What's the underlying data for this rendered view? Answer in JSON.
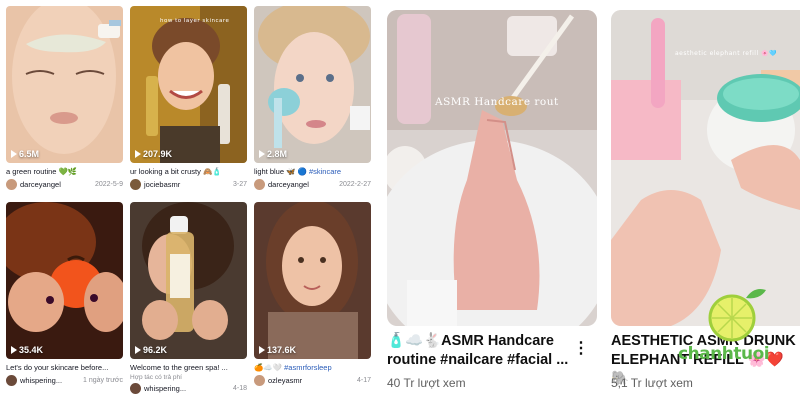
{
  "tiktok": {
    "cards": [
      {
        "views": "6.5M",
        "caption": "a green routine 💚🌿",
        "tag": "",
        "sub": "",
        "user": "darceyangel",
        "date": "2022-5-9"
      },
      {
        "views": "207.9K",
        "caption": "ur looking a bit crusty 🙈🧴",
        "tag": "",
        "sub": "",
        "user": "jociebasmr",
        "date": "3-27",
        "overlay": "how to layer skincare"
      },
      {
        "views": "2.8M",
        "caption": "light blue 🦋 🔵 ",
        "tag": "#skincare",
        "sub": "",
        "user": "darceyangel",
        "date": "2022-2-27"
      },
      {
        "views": "35.4K",
        "caption": "Let's do your skincare before...",
        "tag": "",
        "sub": "",
        "user": "whispering...",
        "date": "1 ngày trước"
      },
      {
        "views": "96.2K",
        "caption": "Welcome to the green spa! ...",
        "tag": "",
        "sub": "Hợp tác có trả phí",
        "user": "whispering...",
        "date": "4-18"
      },
      {
        "views": "137.6K",
        "caption": "🍊☁️🤍 ",
        "tag": "#asmrforsleep",
        "sub": "",
        "user": "ozleyasmr",
        "date": "4-17"
      }
    ]
  },
  "youtube": {
    "left": {
      "overlay": "ASMR Handcare rout",
      "title_line1": "🧴☁️🐇ASMR Handcare",
      "title_line2": "routine #nailcare #facial ...",
      "views": "40 Tr lượt xem",
      "menu": "⋮"
    },
    "right": {
      "overlay": "aesthetic elephant refill 🌸🩵",
      "title_line1": "AESTHETIC ASMR DRUNK",
      "title_line2": "ELEPHANT REFILL 🌸❤️🐘",
      "views": "5,1 Tr lượt xem"
    }
  },
  "watermark": {
    "text": "chanhtuoi",
    "icon": "lime-slice-icon"
  }
}
